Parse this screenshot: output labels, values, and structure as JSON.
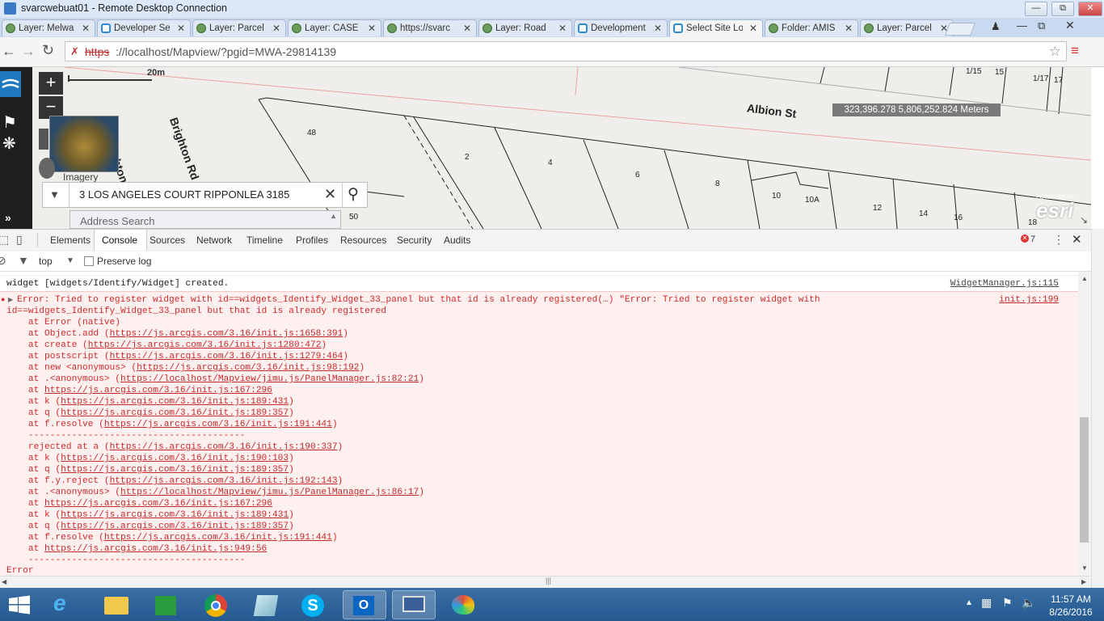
{
  "rdp": {
    "title": "svarcwebuat01 - Remote Desktop Connection",
    "buttons": [
      "—",
      "⧉",
      "✕"
    ]
  },
  "tabs": [
    {
      "label": "Layer: Melwa",
      "icon": "globe-icon"
    },
    {
      "label": "Developer Se",
      "icon": "doc-icon"
    },
    {
      "label": "Layer: Parcel",
      "icon": "globe-icon"
    },
    {
      "label": "Layer: CASE",
      "icon": "globe-icon"
    },
    {
      "label": "https://svarc",
      "icon": "globe-icon"
    },
    {
      "label": "Layer: Road",
      "icon": "globe-icon"
    },
    {
      "label": "Development",
      "icon": "doc-icon"
    },
    {
      "label": "Select Site Lo",
      "icon": "doc-icon",
      "active": true
    },
    {
      "label": "Folder: AMIS",
      "icon": "globe-icon"
    },
    {
      "label": "Layer: Parcel",
      "icon": "globe-icon"
    }
  ],
  "address": {
    "scheme": "https",
    "rest": "://localhost/Mapview/?pgid=MWA-29814139"
  },
  "map": {
    "scale": "20m",
    "overview_label": "Imagery",
    "coords": "323,396.278 5,806,252.824 Meters",
    "streets": [
      "Albion St",
      "Brighton Rd",
      "Brighton Rd"
    ],
    "lots": [
      "48",
      "2",
      "4",
      "6",
      "8",
      "10",
      "10A",
      "12",
      "14",
      "16",
      "18",
      "50",
      "1/15",
      "15",
      "1/17",
      "17"
    ],
    "search_value": "3 LOS ANGELES COURT RIPPONLEA 3185",
    "address_search_placeholder": "Address Search",
    "esri_label": "esri",
    "esri_small": "POWERED BY"
  },
  "devtools": {
    "tabs": [
      "Elements",
      "Console",
      "Sources",
      "Network",
      "Timeline",
      "Profiles",
      "Resources",
      "Security",
      "Audits"
    ],
    "active_tab": "Console",
    "error_count": "7",
    "context": "top",
    "preserve_log": "Preserve log"
  },
  "console": {
    "info_line": "widget [widgets/Identify/Widget] created.",
    "info_src": "WidgetManager.js:115",
    "err_head": "Error: Tried to register widget with id==widgets_Identify_Widget_33_panel but that id is already registered(…) \"Error: Tried to register widget with",
    "err_head2": "id==widgets_Identify_Widget_33_panel but that id is already registered",
    "err_src": "init.js:199",
    "stack": [
      {
        "pre": "    at Error (native)",
        "link": "",
        "post": ""
      },
      {
        "pre": "    at Object.add (",
        "link": "https://js.arcgis.com/3.16/init.js:1658:391",
        "post": ")"
      },
      {
        "pre": "    at create (",
        "link": "https://js.arcgis.com/3.16/init.js:1280:472",
        "post": ")"
      },
      {
        "pre": "    at postscript (",
        "link": "https://js.arcgis.com/3.16/init.js:1279:464",
        "post": ")"
      },
      {
        "pre": "    at new <anonymous> (",
        "link": "https://js.arcgis.com/3.16/init.js:98:192",
        "post": ")"
      },
      {
        "pre": "    at .<anonymous> (",
        "link": "https://localhost/Mapview/jimu.js/PanelManager.js:82:21",
        "post": ")"
      },
      {
        "pre": "    at ",
        "link": "https://js.arcgis.com/3.16/init.js:167:296",
        "post": ""
      },
      {
        "pre": "    at k (",
        "link": "https://js.arcgis.com/3.16/init.js:189:431",
        "post": ")"
      },
      {
        "pre": "    at q (",
        "link": "https://js.arcgis.com/3.16/init.js:189:357",
        "post": ")"
      },
      {
        "pre": "    at f.resolve (",
        "link": "https://js.arcgis.com/3.16/init.js:191:441",
        "post": ")"
      },
      {
        "pre": "    ----------------------------------------",
        "link": "",
        "post": ""
      },
      {
        "pre": "    rejected at a (",
        "link": "https://js.arcgis.com/3.16/init.js:190:337",
        "post": ")"
      },
      {
        "pre": "    at k (",
        "link": "https://js.arcgis.com/3.16/init.js:190:103",
        "post": ")"
      },
      {
        "pre": "    at q (",
        "link": "https://js.arcgis.com/3.16/init.js:189:357",
        "post": ")"
      },
      {
        "pre": "    at f.y.reject (",
        "link": "https://js.arcgis.com/3.16/init.js:192:143",
        "post": ")"
      },
      {
        "pre": "    at .<anonymous> (",
        "link": "https://localhost/Mapview/jimu.js/PanelManager.js:86:17",
        "post": ")"
      },
      {
        "pre": "    at ",
        "link": "https://js.arcgis.com/3.16/init.js:167:296",
        "post": ""
      },
      {
        "pre": "    at k (",
        "link": "https://js.arcgis.com/3.16/init.js:189:431",
        "post": ")"
      },
      {
        "pre": "    at q (",
        "link": "https://js.arcgis.com/3.16/init.js:189:357",
        "post": ")"
      },
      {
        "pre": "    at f.resolve (",
        "link": "https://js.arcgis.com/3.16/init.js:191:441",
        "post": ")"
      },
      {
        "pre": "    at ",
        "link": "https://js.arcgis.com/3.16/init.js:949:56",
        "post": ""
      },
      {
        "pre": "    ----------------------------------------",
        "link": "",
        "post": ""
      }
    ],
    "tail": "Error"
  },
  "taskbar": {
    "items": [
      "start-button",
      "ie-icon",
      "explorer-icon",
      "store-icon",
      "chrome-icon",
      "notepad-icon",
      "skype-icon",
      "outlook-icon",
      "rdp-icon",
      "paint-icon"
    ],
    "time": "11:57 AM",
    "date": "8/26/2016"
  }
}
